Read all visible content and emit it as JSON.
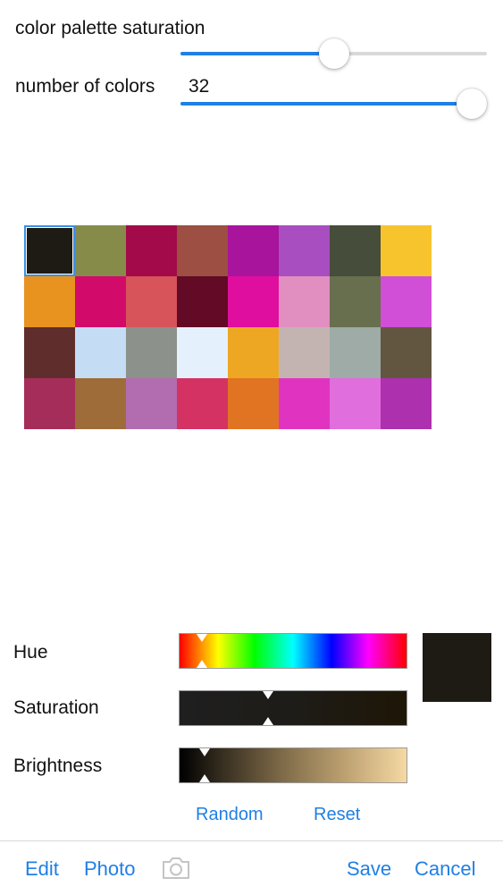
{
  "controls": {
    "saturation_label": "color palette saturation",
    "saturation_value": 0.5,
    "count_label": "number of colors",
    "count_value": "32",
    "count_fraction": 1.0
  },
  "palette": {
    "selected_index": 0,
    "colors": [
      "#1e1a14",
      "#878b4a",
      "#a30a4a",
      "#9c4f42",
      "#a8149c",
      "#a84ec0",
      "#464d3a",
      "#f7c42d",
      "#e8921f",
      "#d20a6a",
      "#d6545a",
      "#620a26",
      "#e00e9e",
      "#e08fc0",
      "#686f4e",
      "#d14ed6",
      "#5f2e2c",
      "#c5dcf5",
      "#8d918b",
      "#e4f0fb",
      "#eea722",
      "#c3b4b2",
      "#9eaba6",
      "#635640",
      "#a52d5a",
      "#9e6c38",
      "#b26cb0",
      "#d43262",
      "#e07422",
      "#e034c0",
      "#e06edc",
      "#ad30ae"
    ]
  },
  "adjust": {
    "hue_label": "Hue",
    "saturation_label": "Saturation",
    "brightness_label": "Brightness",
    "hue_value": 0.1,
    "saturation_value": 0.39,
    "brightness_value": 0.11,
    "preview_color": "#1e1a14",
    "random_label": "Random",
    "reset_label": "Reset"
  },
  "toolbar": {
    "edit_label": "Edit",
    "photo_label": "Photo",
    "camera_icon": "camera-icon",
    "save_label": "Save",
    "cancel_label": "Cancel"
  },
  "accent_color": "#1f7fe5"
}
